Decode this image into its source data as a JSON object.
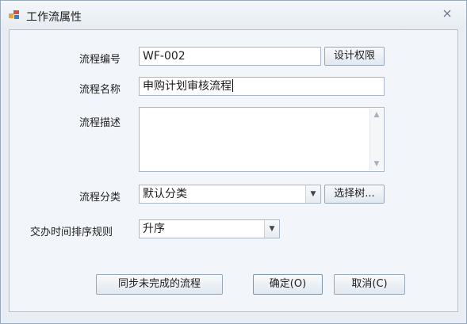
{
  "window": {
    "title": "工作流属性",
    "close_glyph": "⤧"
  },
  "form": {
    "code_label": "流程编号",
    "code_value": "WF-002",
    "permission_button": "设计权限",
    "name_label": "流程名称",
    "name_value": "申购计划审核流程",
    "desc_label": "流程描述",
    "desc_value": "",
    "category_label": "流程分类",
    "category_value": "默认分类",
    "select_tree_button": "选择树...",
    "sort_label": "交办时间排序规则",
    "sort_value": "升序"
  },
  "buttons": {
    "sync_label": "同步未完成的流程",
    "ok_label": "确定(O)",
    "cancel_label": "取消(C)"
  },
  "icons": {
    "window": "app-window-icon",
    "close": "close-icon",
    "scroll_up": "scroll-up-icon",
    "scroll_down": "scroll-down-icon",
    "dropdown": "chevron-down-icon"
  }
}
